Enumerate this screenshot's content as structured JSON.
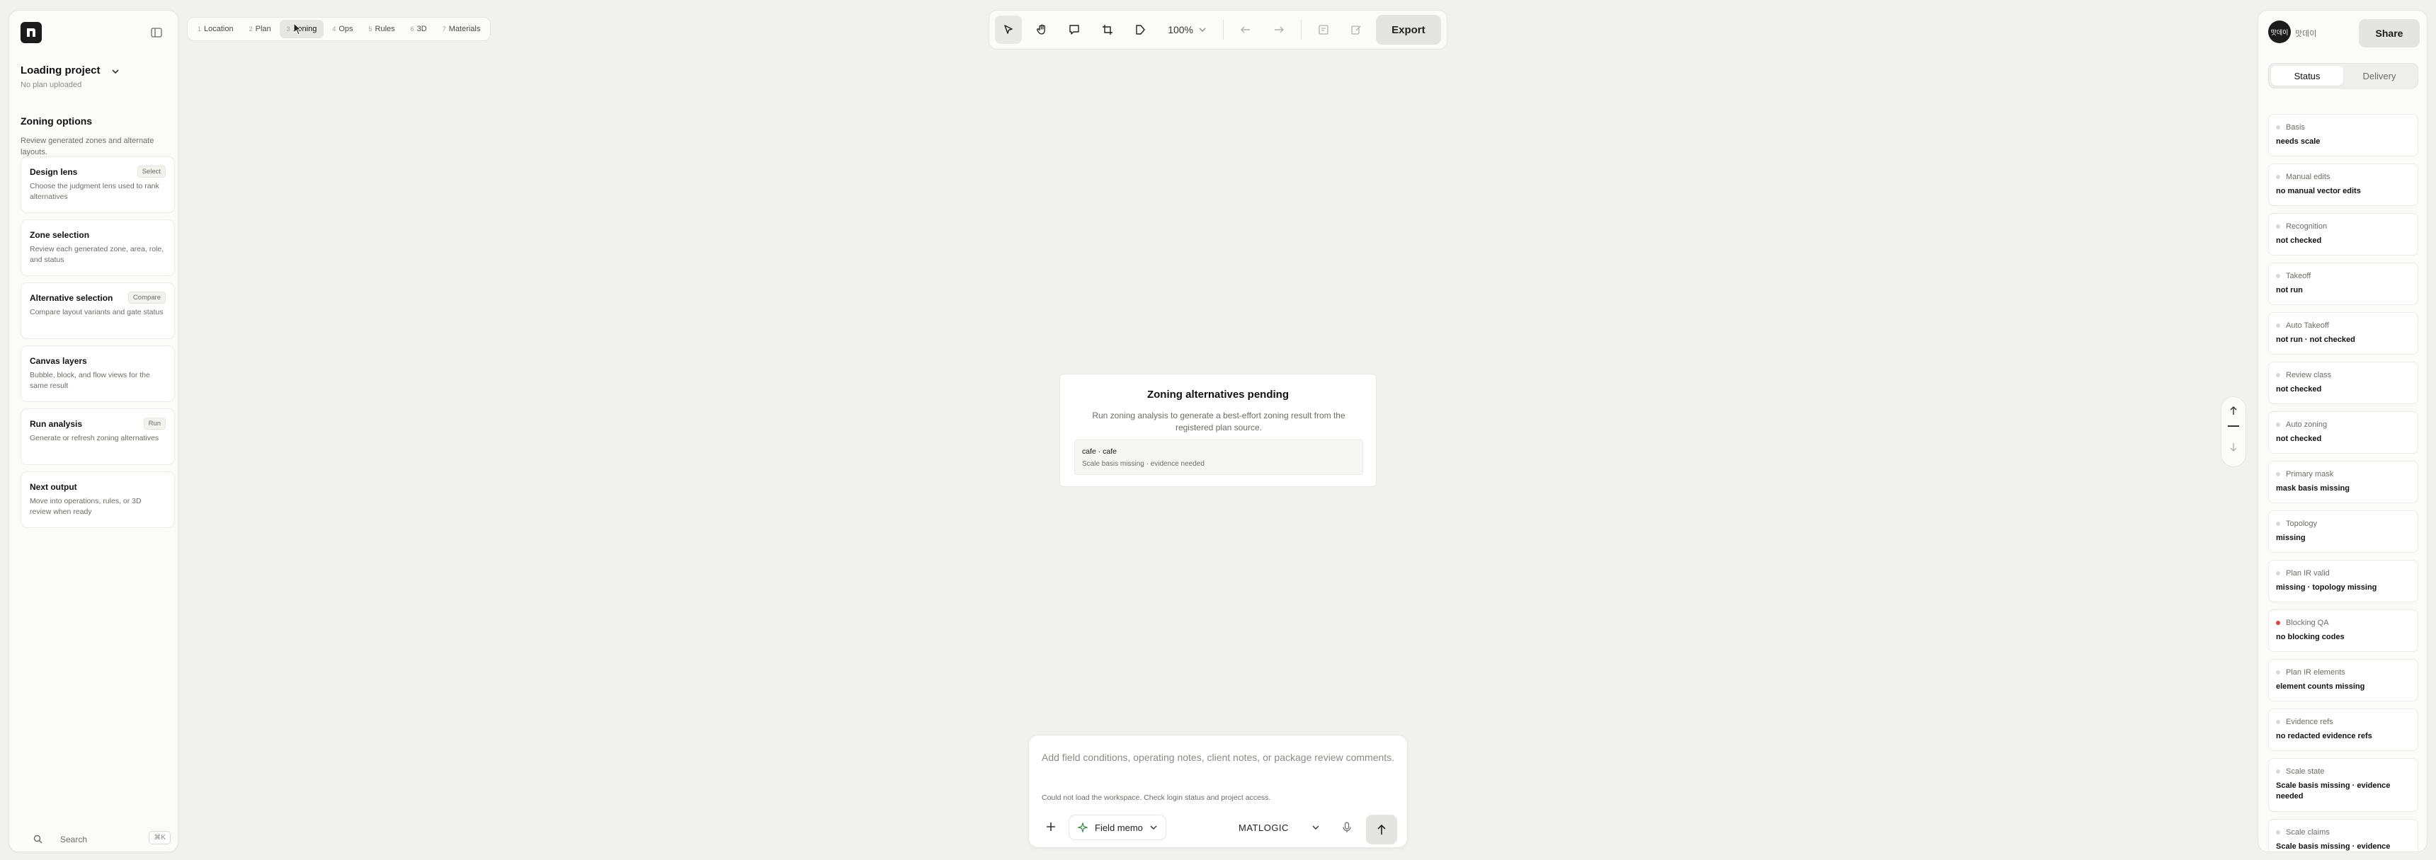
{
  "project": {
    "title": "Loading project",
    "subtitle": "No plan uploaded"
  },
  "zoning": {
    "title": "Zoning options",
    "description": "Review generated zones and alternate layouts.",
    "cards": [
      {
        "title": "Design lens",
        "desc": "Choose the judgment lens used to rank alternatives",
        "badge": "Select"
      },
      {
        "title": "Zone selection",
        "desc": "Review each generated zone, area, role, and status",
        "badge": ""
      },
      {
        "title": "Alternative selection",
        "desc": "Compare layout variants and gate status",
        "badge": "Compare"
      },
      {
        "title": "Canvas layers",
        "desc": "Bubble, block, and flow views for the same result",
        "badge": ""
      },
      {
        "title": "Run analysis",
        "desc": "Generate or refresh zoning alternatives",
        "badge": "Run"
      },
      {
        "title": "Next output",
        "desc": "Move into operations, rules, or 3D review when ready",
        "badge": ""
      }
    ]
  },
  "search": {
    "label": "Search",
    "shortcut": "⌘K"
  },
  "stages": [
    {
      "num": "1",
      "label": "Location"
    },
    {
      "num": "2",
      "label": "Plan"
    },
    {
      "num": "3",
      "label": "Zoning"
    },
    {
      "num": "4",
      "label": "Ops"
    },
    {
      "num": "5",
      "label": "Rules"
    },
    {
      "num": "6",
      "label": "3D"
    },
    {
      "num": "7",
      "label": "Materials"
    }
  ],
  "toolbar": {
    "zoom": "100%",
    "export_label": "Export",
    "icons": [
      "select-icon",
      "pan-icon",
      "comment-icon",
      "crop-icon",
      "tag-icon",
      "undo-icon",
      "redo-icon",
      "notes-icon",
      "edit-icon"
    ]
  },
  "pending": {
    "title": "Zoning alternatives pending",
    "description": "Run zoning analysis to generate a best-effort zoning result from the registered plan source.",
    "source_name": "cafe · cafe",
    "source_status": "Scale basis missing · evidence needed"
  },
  "user": {
    "avatar": "맛데이",
    "name": "맛데이"
  },
  "share_label": "Share",
  "right_tabs": {
    "status": "Status",
    "delivery": "Delivery"
  },
  "status_items": [
    {
      "label": "Basis",
      "value": "needs scale",
      "alert": false
    },
    {
      "label": "Manual edits",
      "value": "no manual vector edits",
      "alert": false
    },
    {
      "label": "Recognition",
      "value": "not checked",
      "alert": false
    },
    {
      "label": "Takeoff",
      "value": "not run",
      "alert": false
    },
    {
      "label": "Auto Takeoff",
      "value": "not run · not checked",
      "alert": false
    },
    {
      "label": "Review class",
      "value": "not checked",
      "alert": false
    },
    {
      "label": "Auto zoning",
      "value": "not checked",
      "alert": false
    },
    {
      "label": "Primary mask",
      "value": "mask basis missing",
      "alert": false
    },
    {
      "label": "Topology",
      "value": "missing",
      "alert": false
    },
    {
      "label": "Plan IR valid",
      "value": "missing · topology missing",
      "alert": false
    },
    {
      "label": "Blocking QA",
      "value": "no blocking codes",
      "alert": true
    },
    {
      "label": "Plan IR elements",
      "value": "element counts missing",
      "alert": false
    },
    {
      "label": "Evidence refs",
      "value": "no redacted evidence refs",
      "alert": false
    },
    {
      "label": "Scale state",
      "value": "Scale basis missing · evidence needed",
      "alert": false
    },
    {
      "label": "Scale claims",
      "value": "Scale basis missing · evidence",
      "alert": false
    }
  ],
  "composer": {
    "placeholder": "Add field conditions, operating notes, client notes, or package review comments.",
    "error": "Could not load the workspace. Check login status and project access.",
    "memo_label": "Field memo",
    "model_label": "MATLOGIC"
  },
  "colors": {
    "accent_dark": "#1c1c1c",
    "alert": "#e0452e",
    "background": "#f1f1f0"
  }
}
